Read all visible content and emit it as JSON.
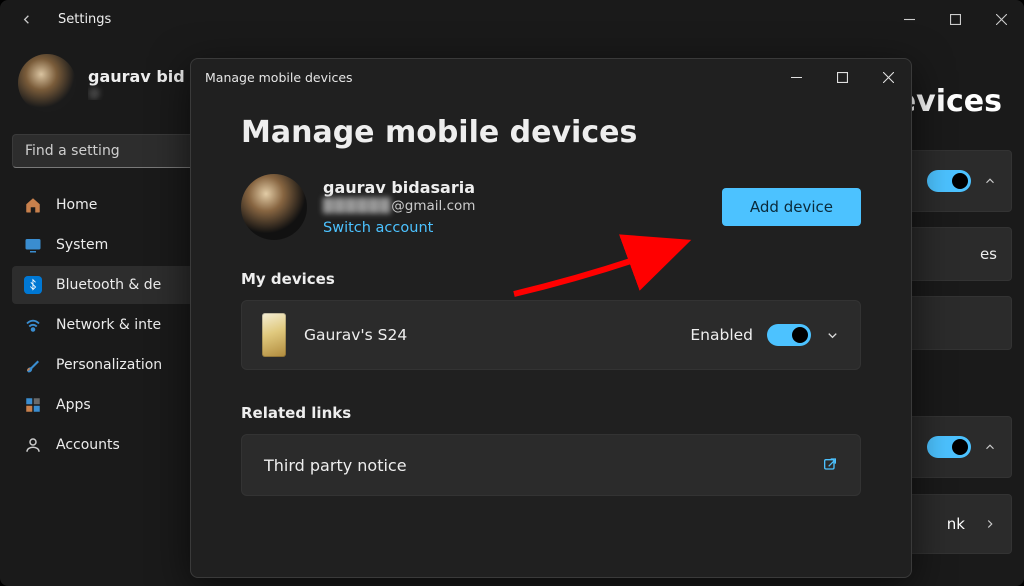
{
  "settings": {
    "title": "Settings",
    "profile": {
      "name": "gaurav bid",
      "email_indicator": "@"
    },
    "search_placeholder": "Find a setting",
    "nav": [
      {
        "label": "Home"
      },
      {
        "label": "System"
      },
      {
        "label": "Bluetooth & de"
      },
      {
        "label": "Network & inte"
      },
      {
        "label": "Personalization"
      },
      {
        "label": "Apps"
      },
      {
        "label": "Accounts"
      }
    ],
    "bg_heading_fragment": "evices",
    "bg_card2_label": "es",
    "bg_card5_label": "nk"
  },
  "dialog": {
    "window_title": "Manage mobile devices",
    "heading": "Manage mobile devices",
    "account": {
      "name": "gaurav bidasaria",
      "email_hidden": "██████",
      "email_visible": "@gmail.com",
      "switch_label": "Switch account"
    },
    "add_device_label": "Add device",
    "my_devices_label": "My devices",
    "device": {
      "name": "Gaurav's S24",
      "status": "Enabled"
    },
    "related_links_label": "Related links",
    "link_item": "Third party notice"
  }
}
